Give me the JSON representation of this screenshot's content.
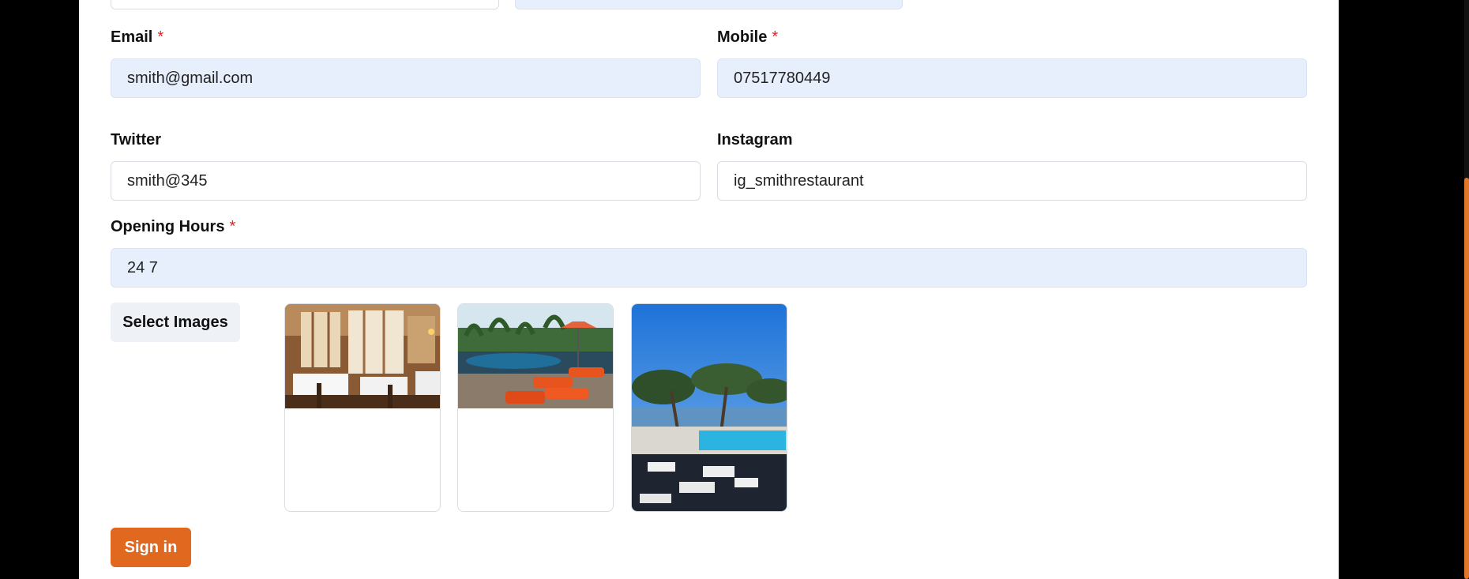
{
  "form": {
    "email": {
      "label": "Email",
      "required_mark": "*",
      "value": "smith@gmail.com"
    },
    "mobile": {
      "label": "Mobile",
      "required_mark": "*",
      "value": "07517780449"
    },
    "twitter": {
      "label": "Twitter",
      "value": "smith@345"
    },
    "instagram": {
      "label": "Instagram",
      "value": "ig_smithrestaurant"
    },
    "opening_hours": {
      "label": "Opening Hours",
      "required_mark": "*",
      "value": "24 7"
    }
  },
  "images": {
    "select_label": "Select Images",
    "items": [
      {
        "name": "restaurant-interior-image"
      },
      {
        "name": "poolside-loungers-image"
      },
      {
        "name": "seaside-pool-terrace-image"
      }
    ]
  },
  "actions": {
    "submit_label": "Sign in"
  },
  "colors": {
    "accent": "#e0691f",
    "filled_input_bg": "#e8effc",
    "required": "#dc2626"
  }
}
